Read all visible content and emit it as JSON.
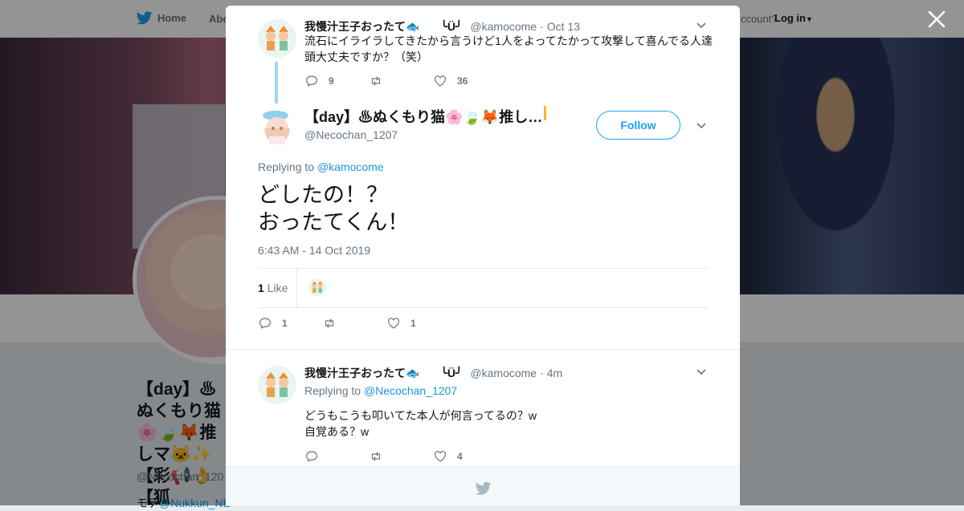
{
  "background": {
    "nav": {
      "home": "Home",
      "about": "Abo"
    },
    "account_prompt": "ccount?",
    "login": "Log in",
    "profile": {
      "name": "【day】♨ぬくもり猫🌸🍃🦊推しマ🐱✨【彩📢👌【狐",
      "handle": "@Necochan_120",
      "bio_prefix": "モデ",
      "bio_link": "@Nukkun_NE"
    }
  },
  "modal": {
    "parent_tweet": {
      "name": "我慢汁王子おったて🐟",
      "emoticon": "╰Ü╯",
      "handle": "@kamocome",
      "date": "Oct 13",
      "text": "流石にイライラしてきたから言うけど1人をよってたかって攻撃して喜んでる人達頭大丈夫ですか？（笑）",
      "replies": "9",
      "retweets": "",
      "likes": "36"
    },
    "main_tweet": {
      "name": "【day】♨ぬくもり猫🌸🍃🦊推し…",
      "handle": "@Necochan_1207",
      "follow_label": "Follow",
      "replying_prefix": "Replying to ",
      "replying_to": "@kamocome",
      "text": "どしたの！？\nおったてくん！",
      "timestamp": "6:43 AM - 14 Oct 2019",
      "like_count": "1",
      "like_label": "Like",
      "replies": "1",
      "retweets": "",
      "likes": "1"
    },
    "reply_tweet": {
      "name": "我慢汁王子おったて🐟",
      "emoticon": "╰Ü╯",
      "handle": "@kamocome",
      "date": "4m",
      "replying_prefix": "Replying to ",
      "replying_to": "@Necochan_1207",
      "text_line1": "どうもこうも叩いてた本人が何言ってるの？w",
      "text_line2": "自覚ある？w",
      "replies": "",
      "retweets": "",
      "likes": "4"
    }
  },
  "colors": {
    "accent": "#1da1f2",
    "link": "#1b95e0",
    "muted": "#657786",
    "text": "#14171a"
  }
}
